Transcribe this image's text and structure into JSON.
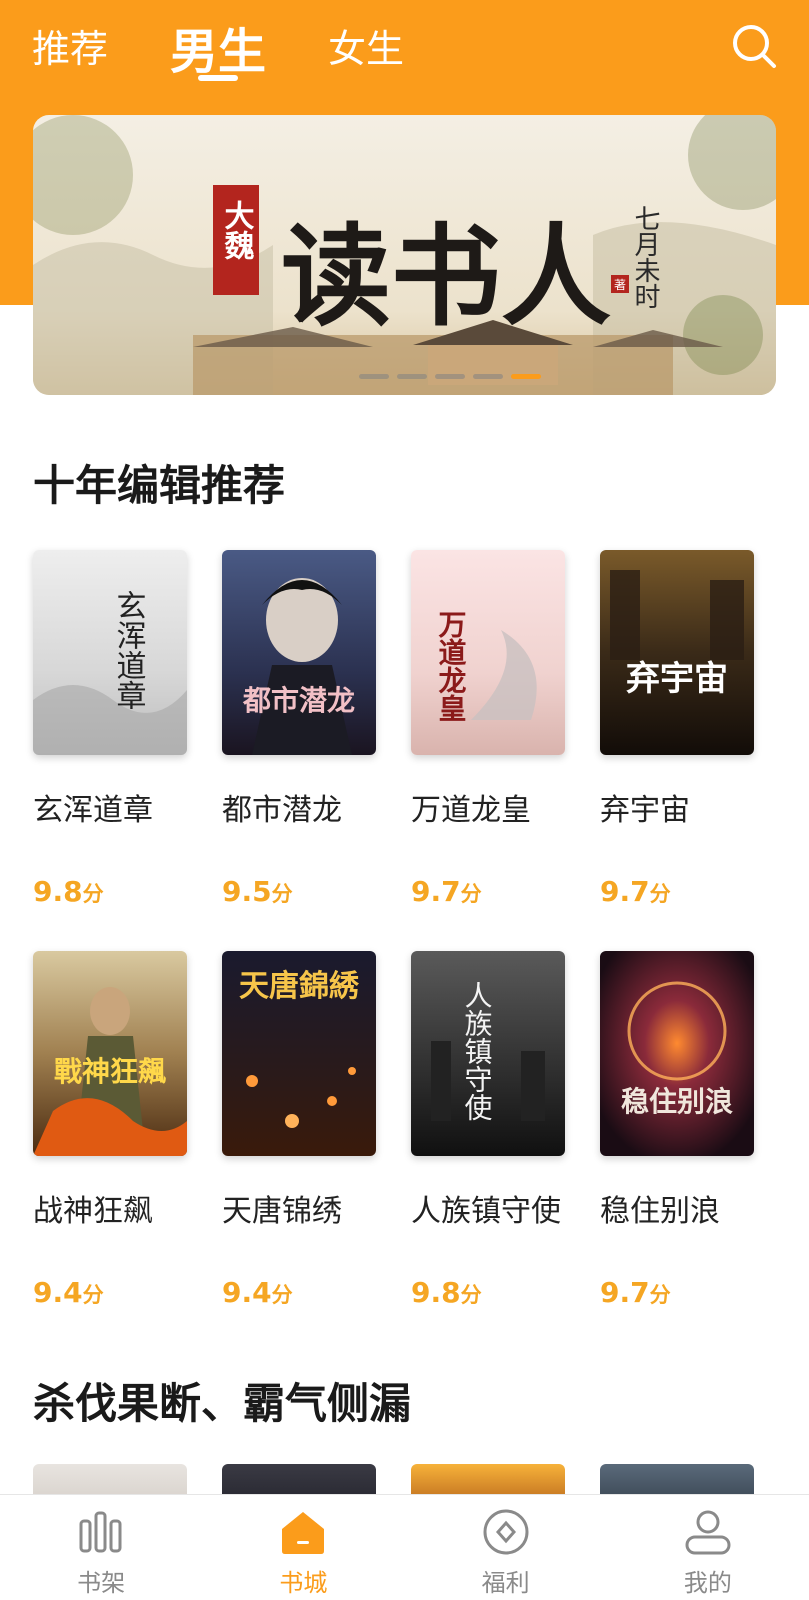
{
  "header": {
    "tabs": [
      {
        "label": "推荐",
        "active": false
      },
      {
        "label": "男生",
        "active": true
      },
      {
        "label": "女生",
        "active": false
      }
    ],
    "search_icon": "search-icon",
    "background_color": "#fb9c1b"
  },
  "banner": {
    "book_title": "大魏读书人",
    "title_prefix": "大魏",
    "title_main": "读书人",
    "author": "七月未时",
    "author_seal": "著",
    "slides_total": 5,
    "active_slide": 5
  },
  "sections": [
    {
      "title": "十年编辑推荐",
      "books": [
        {
          "title": "玄浑道章",
          "score": "9.8",
          "unit": "分",
          "cover_text": "玄浑道章"
        },
        {
          "title": "都市潜龙",
          "score": "9.5",
          "unit": "分",
          "cover_text": "都市潜龙"
        },
        {
          "title": "万道龙皇",
          "score": "9.7",
          "unit": "分",
          "cover_text": "万道龙皇"
        },
        {
          "title": "弃宇宙",
          "score": "9.7",
          "unit": "分",
          "cover_text": "弃宇宙"
        },
        {
          "title": "战神狂飙",
          "score": "9.4",
          "unit": "分",
          "cover_text": "戰神狂飆"
        },
        {
          "title": "天唐锦绣",
          "score": "9.4",
          "unit": "分",
          "cover_text": "天唐錦綉"
        },
        {
          "title": "人族镇守使",
          "score": "9.8",
          "unit": "分",
          "cover_text": "人族镇守使"
        },
        {
          "title": "稳住别浪",
          "score": "9.7",
          "unit": "分",
          "cover_text": "稳住别浪"
        }
      ]
    },
    {
      "title": "杀伐果断、霸气侧漏"
    }
  ],
  "bottom_nav": [
    {
      "label": "书架",
      "icon": "bookshelf-icon",
      "active": false
    },
    {
      "label": "书城",
      "icon": "home-icon",
      "active": true
    },
    {
      "label": "福利",
      "icon": "coin-icon",
      "active": false
    },
    {
      "label": "我的",
      "icon": "user-icon",
      "active": false
    }
  ],
  "colors": {
    "accent": "#fb9c1b",
    "score": "#f5a623",
    "nav_inactive": "#8a8a8a"
  }
}
